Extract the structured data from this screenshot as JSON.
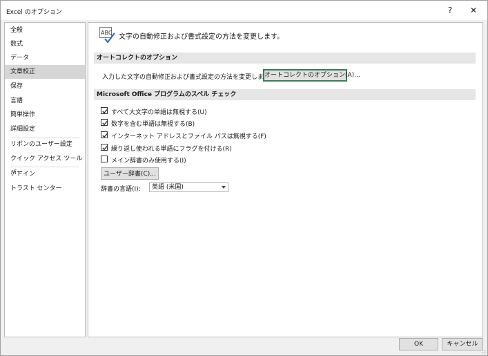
{
  "window": {
    "title": "Excel のオプション",
    "help_label": "?",
    "close_label": "✕"
  },
  "nav": {
    "items": [
      {
        "label": "全般"
      },
      {
        "label": "数式"
      },
      {
        "label": "データ"
      },
      {
        "label": "文章校正",
        "selected": true
      },
      {
        "label": "保存"
      },
      {
        "label": "言語"
      },
      {
        "label": "簡単操作"
      },
      {
        "label": "詳細設定"
      },
      {
        "label": "リボンのユーザー設定"
      },
      {
        "label": "クイック アクセス ツール バー"
      },
      {
        "label": "アドイン"
      },
      {
        "label": "トラスト センター"
      }
    ]
  },
  "header": {
    "icon_text": "ABC",
    "text": "文字の自動修正および書式設定の方法を変更します。"
  },
  "autocorrect": {
    "section_title": "オートコレクトのオプション",
    "description": "入力した文字の自動修正および書式設定の方法を変更します:",
    "button_label": "オートコレクトのオプション(A)..."
  },
  "spelling": {
    "section_title": "Microsoft Office プログラムのスペル チェック",
    "checkboxes": [
      {
        "label": "すべて大文字の単語は無視する(U)",
        "checked": true
      },
      {
        "label": "数字を含む単語は無視する(B)",
        "checked": true
      },
      {
        "label": "インターネット アドレスとファイル パスは無視する(F)",
        "checked": true
      },
      {
        "label": "繰り返し使われる単語にフラグを付ける(R)",
        "checked": true
      },
      {
        "label": "メイン辞書のみ使用する(I)",
        "checked": false
      }
    ],
    "user_dict_button": "ユーザー辞書(C)...",
    "language_label": "辞書の言語(I):",
    "language_value": "英語 (米国)"
  },
  "footer": {
    "ok_label": "OK",
    "cancel_label": "キャンセル"
  },
  "colors": {
    "focus_border": "#3c7a55",
    "selected_nav": "#d6d6d6",
    "section_bg": "#e6e6e6"
  }
}
